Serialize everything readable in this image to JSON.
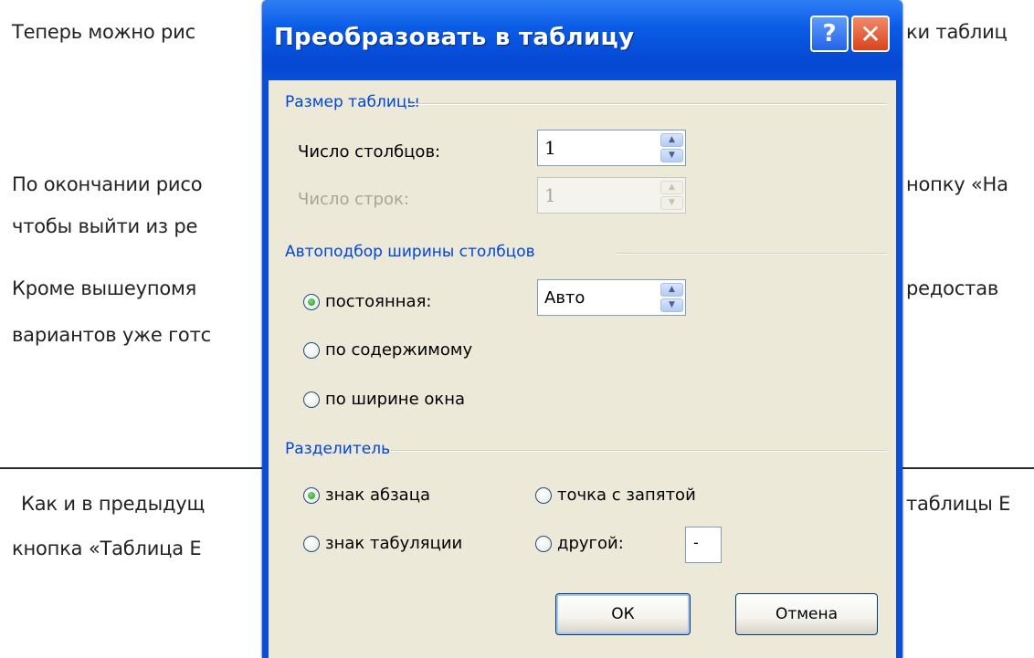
{
  "document": {
    "lines": [
      "Теперь можно рис",
      "ки таблиц",
      "По окончании рисо",
      "нопку «На",
      "чтобы выйти из ре",
      "Кроме вышеупомя",
      "редостав",
      "вариантов уже готс",
      "Как и в предыдущ",
      "таблицы Е",
      "кнопка «Таблица Е"
    ]
  },
  "dialog": {
    "title": "Преобразовать в таблицу",
    "help_label": "?",
    "close_label": "✕",
    "table_size": {
      "group_label": "Размер таблицы",
      "columns_label": "Число столбцов:",
      "columns_value": "1",
      "rows_label": "Число строк:",
      "rows_value": "1"
    },
    "autofit": {
      "group_label": "Автоподбор ширины столбцов",
      "options": [
        "постоянная:",
        "по содержимому",
        "по ширине окна"
      ],
      "selected": "постоянная:",
      "fixed_value": "Авто"
    },
    "separator": {
      "group_label": "Разделитель",
      "options": [
        "знак абзаца",
        "точка с запятой",
        "знак табуляции",
        "другой:"
      ],
      "selected": "знак абзаца",
      "other_value": "-"
    },
    "buttons": {
      "ok": "ОК",
      "cancel": "Отмена"
    }
  },
  "colors": {
    "titlebar": "#0a5be6",
    "group_label": "#0046d5",
    "dialog_body": "#ece9d8"
  }
}
